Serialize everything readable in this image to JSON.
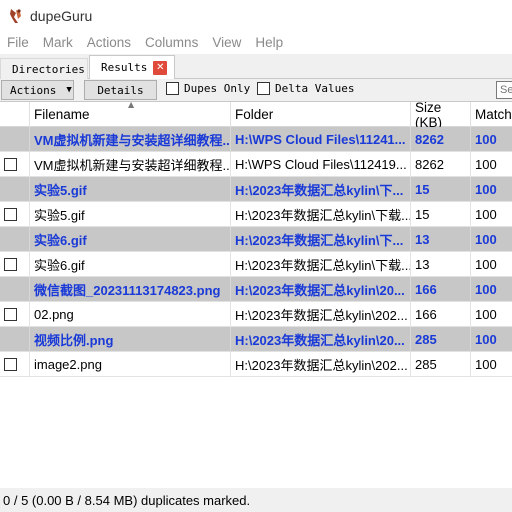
{
  "window": {
    "title": "dupeGuru",
    "icon": "dupeguru-app-icon"
  },
  "menu": [
    "File",
    "Mark",
    "Actions",
    "Columns",
    "View",
    "Help"
  ],
  "tabs": {
    "directories": "Directories",
    "results": "Results",
    "close_icon": "close-icon"
  },
  "toolbar": {
    "actions_label": "Actions",
    "details_label": "Details",
    "dupes_only_label": "Dupes Only",
    "delta_values_label": "Delta Values",
    "search_placeholder": "Se"
  },
  "table": {
    "headers": {
      "filename": "Filename",
      "folder": "Folder",
      "size": "Size (KB)",
      "match": "Match"
    },
    "rows": [
      {
        "type": "ref",
        "filename": "VM虚拟机新建与安装超详细教程....",
        "folder": "H:\\WPS Cloud Files\\11241...",
        "size": "8262",
        "match": "100"
      },
      {
        "type": "dupe",
        "filename": "VM虚拟机新建与安装超详细教程....",
        "folder": "H:\\WPS Cloud Files\\112419...",
        "size": "8262",
        "match": "100"
      },
      {
        "type": "ref",
        "filename": "实验5.gif",
        "folder": "H:\\2023年数据汇总kylin\\下...",
        "size": "15",
        "match": "100"
      },
      {
        "type": "dupe",
        "filename": "实验5.gif",
        "folder": "H:\\2023年数据汇总kylin\\下载...",
        "size": "15",
        "match": "100"
      },
      {
        "type": "ref",
        "filename": "实验6.gif",
        "folder": "H:\\2023年数据汇总kylin\\下...",
        "size": "13",
        "match": "100"
      },
      {
        "type": "dupe",
        "filename": "实验6.gif",
        "folder": "H:\\2023年数据汇总kylin\\下载...",
        "size": "13",
        "match": "100"
      },
      {
        "type": "ref",
        "filename": "微信截图_20231113174823.png",
        "folder": "H:\\2023年数据汇总kylin\\20...",
        "size": "166",
        "match": "100"
      },
      {
        "type": "dupe",
        "filename": "02.png",
        "folder": "H:\\2023年数据汇总kylin\\202...",
        "size": "166",
        "match": "100"
      },
      {
        "type": "ref",
        "filename": "视频比例.png",
        "folder": "H:\\2023年数据汇总kylin\\20...",
        "size": "285",
        "match": "100"
      },
      {
        "type": "dupe",
        "filename": "image2.png",
        "folder": "H:\\2023年数据汇总kylin\\202...",
        "size": "285",
        "match": "100"
      }
    ]
  },
  "status": "0 / 5 (0.00 B / 8.54 MB) duplicates marked.",
  "colors": {
    "reference_row_bg": "#c7c7c7",
    "reference_text": "#1a3ad8",
    "close_tab": "#e04a3a"
  }
}
